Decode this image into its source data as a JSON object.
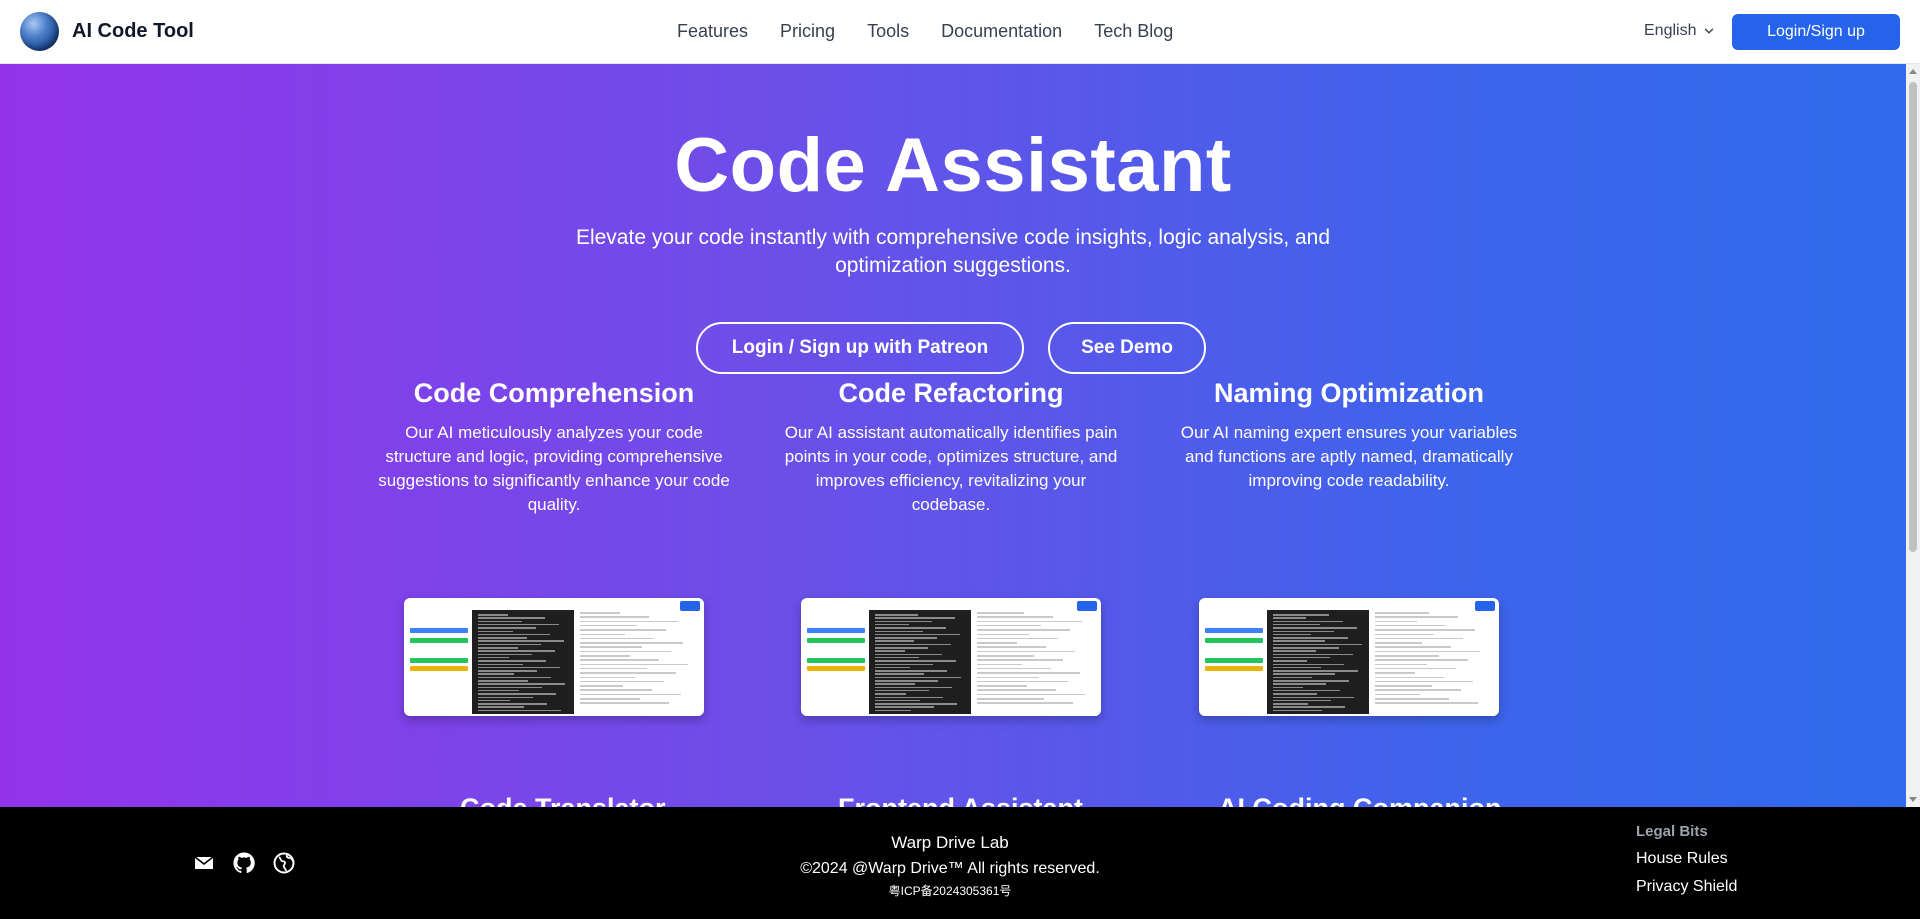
{
  "header": {
    "brand": "AI Code Tool",
    "nav": [
      "Features",
      "Pricing",
      "Tools",
      "Documentation",
      "Tech Blog"
    ],
    "language": "English",
    "login_label": "Login/Sign up"
  },
  "hero": {
    "title": "Code Assistant",
    "subtitle": "Elevate your code instantly with comprehensive code insights, logic analysis, and optimization suggestions.",
    "primary_button": "Login / Sign up with Patreon",
    "secondary_button": "See Demo"
  },
  "features": [
    {
      "title": "Code Comprehension",
      "description": "Our AI meticulously analyzes your code structure and logic, providing comprehensive suggestions to significantly enhance your code quality."
    },
    {
      "title": "Code Refactoring",
      "description": "Our AI assistant automatically identifies pain points in your code, optimizes structure, and improves efficiency, revitalizing your codebase."
    },
    {
      "title": "Naming Optimization",
      "description": "Our AI naming expert ensures your variables and functions are aptly named, dramatically improving code readability."
    }
  ],
  "features_row2": [
    "Code Translator",
    "Frontend Assistant",
    "AI Coding Companion"
  ],
  "footer": {
    "icons": [
      "mail-icon",
      "github-icon",
      "globe-icon"
    ],
    "company": "Warp Drive Lab",
    "copyright": "©2024 @Warp Drive™ All rights reserved.",
    "icp": "粤ICP备2024305361号",
    "legal_heading": "Legal Bits",
    "legal_links": [
      "House Rules",
      "Privacy Shield"
    ]
  },
  "colors": {
    "primary": "#2563eb",
    "gradient_start": "#9333ea",
    "gradient_end": "#2f6bec"
  }
}
